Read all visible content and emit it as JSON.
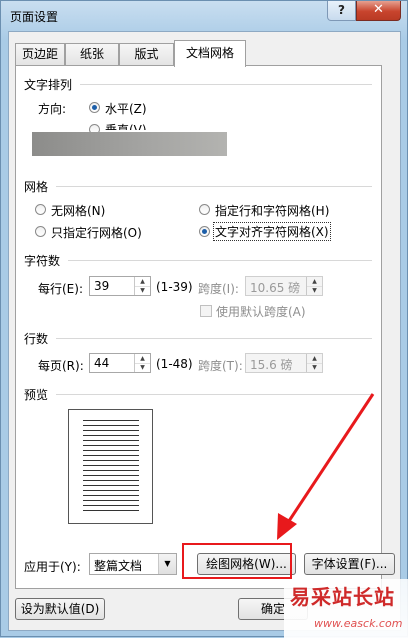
{
  "window": {
    "title": "页面设置",
    "help_label": "?",
    "close_label": "✕"
  },
  "tabs": [
    {
      "label": "页边距",
      "active": false
    },
    {
      "label": "纸张",
      "active": false
    },
    {
      "label": "版式",
      "active": false
    },
    {
      "label": "文档网格",
      "active": true
    }
  ],
  "text_direction": {
    "group_title": "文字排列",
    "direction_label": "方向:",
    "options": [
      {
        "label": "水平(Z)",
        "selected": true
      },
      {
        "label": "垂直(V)",
        "selected": false
      }
    ]
  },
  "grid": {
    "group_title": "网格",
    "options": [
      {
        "label": "无网格(N)",
        "selected": false
      },
      {
        "label": "指定行和字符网格(H)",
        "selected": false
      },
      {
        "label": "只指定行网格(O)",
        "selected": false
      },
      {
        "label": "文字对齐字符网格(X)",
        "selected": true
      }
    ]
  },
  "characters": {
    "group_title": "字符数",
    "per_line_label": "每行(E):",
    "per_line_value": "39",
    "per_line_range": "(1-39)",
    "pitch_label": "跨度(I):",
    "pitch_value": "10.65 磅",
    "default_pitch_label": "使用默认跨度(A)"
  },
  "lines": {
    "group_title": "行数",
    "per_page_label": "每页(R):",
    "per_page_value": "44",
    "per_page_range": "(1-48)",
    "pitch_label": "跨度(T):",
    "pitch_value": "15.6 磅"
  },
  "preview": {
    "group_title": "预览"
  },
  "apply": {
    "label": "应用于(Y):",
    "value": "整篇文档",
    "drawing_grid_label": "绘图网格(W)...",
    "font_settings_label": "字体设置(F)..."
  },
  "footer": {
    "set_default_label": "设为默认值(D)",
    "ok_label": "确定"
  },
  "watermark": {
    "text": "易采站长站",
    "url": "www.easck.com"
  },
  "colors": {
    "highlight": "#e8191c",
    "arrow": "#e8191c",
    "selected_radio": "#1d5fa9"
  }
}
